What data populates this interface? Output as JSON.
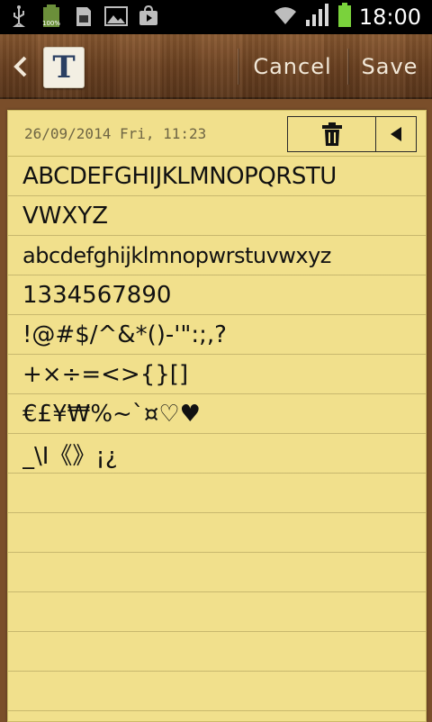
{
  "status_bar": {
    "time": "18:00",
    "icons": [
      "usb-icon",
      "battery-100-icon",
      "sd-card-icon",
      "image-icon",
      "play-store-icon"
    ],
    "right_icons": [
      "wifi-icon",
      "signal-icon",
      "battery-icon"
    ]
  },
  "title_bar": {
    "cancel_label": "Cancel",
    "save_label": "Save",
    "app_icon_glyph": "T"
  },
  "note": {
    "date": "26/09/2014 Fri, 11:23",
    "lines": [
      "ABCDEFGHIJKLMNOPQRSTU",
      "VWXYZ",
      "abcdefghijklmnopwrstuvwxyz",
      "1334567890",
      "!@#$/^&*()-'\":;,?",
      "+×÷=<>{}[]",
      "€£¥₩%~`¤♡♥",
      "_\\I《》¡¿"
    ]
  },
  "colors": {
    "paper": "#f1e08c",
    "wood": "#6e4322",
    "battery_green": "#7ad23c"
  }
}
